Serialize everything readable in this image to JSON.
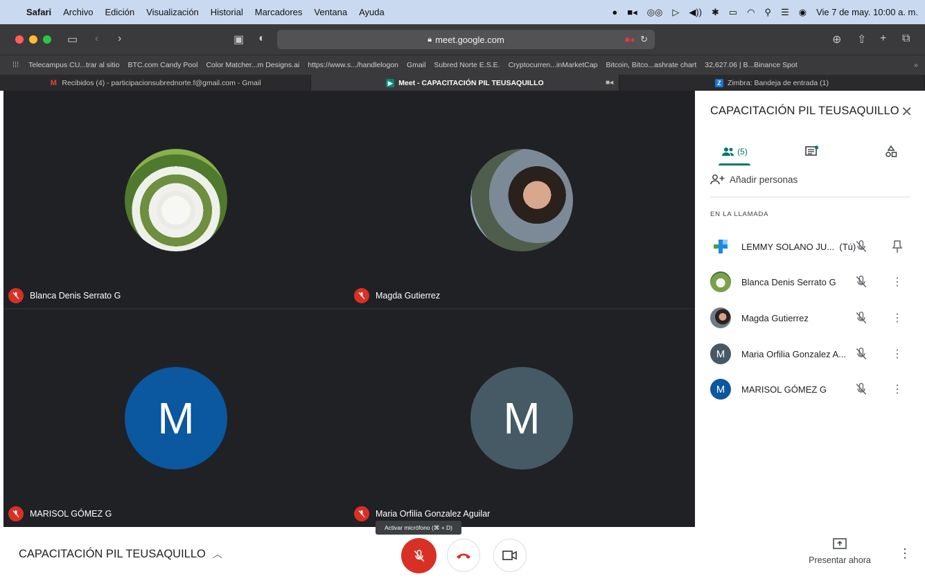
{
  "menubar": {
    "app": "Safari",
    "items": [
      "Archivo",
      "Edición",
      "Visualización",
      "Historial",
      "Marcadores",
      "Ventana",
      "Ayuda"
    ],
    "clock": "Vie 7 de may.  10:00 a. m."
  },
  "browser": {
    "url": "meet.google.com",
    "bookmarks": [
      "Telecampus CU...trar al sitio",
      "BTC.com Candy Pool",
      "Color Matcher...m Designs.ai",
      "https://www.s.../handlelogon",
      "Gmail",
      "Subred Norte E.S.E.",
      "Cryptocurren...inMarketCap",
      "Bitcoin, Bitco...ashrate chart",
      "32,627.06 | B...Binance Spot"
    ],
    "tabs": [
      {
        "title": "Recibidos (4) - participacionsubrednorte.f@gmail.com - Gmail"
      },
      {
        "title": "Meet - CAPACITACIÓN PIL TEUSAQUILLO"
      },
      {
        "title": "Zimbra: Bandeja de entrada (1)"
      }
    ]
  },
  "tiles": [
    {
      "name": "Blanca Denis Serrato G"
    },
    {
      "name": "Magda Gutierrez"
    },
    {
      "name": "MARISOL GÓMEZ G",
      "initial": "M",
      "color": "#0b57a0"
    },
    {
      "name": "Maria Orfilia Gonzalez Aguilar",
      "initial": "M",
      "color": "#455a64"
    }
  ],
  "panel": {
    "title": "CAPACITACIÓN PIL TEUSAQUILLO",
    "people_count": "(5)",
    "add_people": "Añadir personas",
    "section": "EN LA LLAMADA",
    "participants": [
      {
        "name": "LEMMY SOLANO JU...",
        "you": "(Tú)"
      },
      {
        "name": "Blanca Denis Serrato G"
      },
      {
        "name": "Magda Gutierrez"
      },
      {
        "name": "Maria Orfilia Gonzalez A...",
        "initial": "M",
        "color": "#455a64"
      },
      {
        "name": "MARISOL GÓMEZ G",
        "initial": "M",
        "color": "#0b57a0"
      }
    ]
  },
  "bottom": {
    "meeting_title": "CAPACITACIÓN PIL TEUSAQUILLO",
    "tooltip": "Activar micrófono (⌘ + D)",
    "present": "Presentar ahora"
  },
  "colors": {
    "accent": "#00796b",
    "danger": "#d93025",
    "dark": "#202124"
  }
}
